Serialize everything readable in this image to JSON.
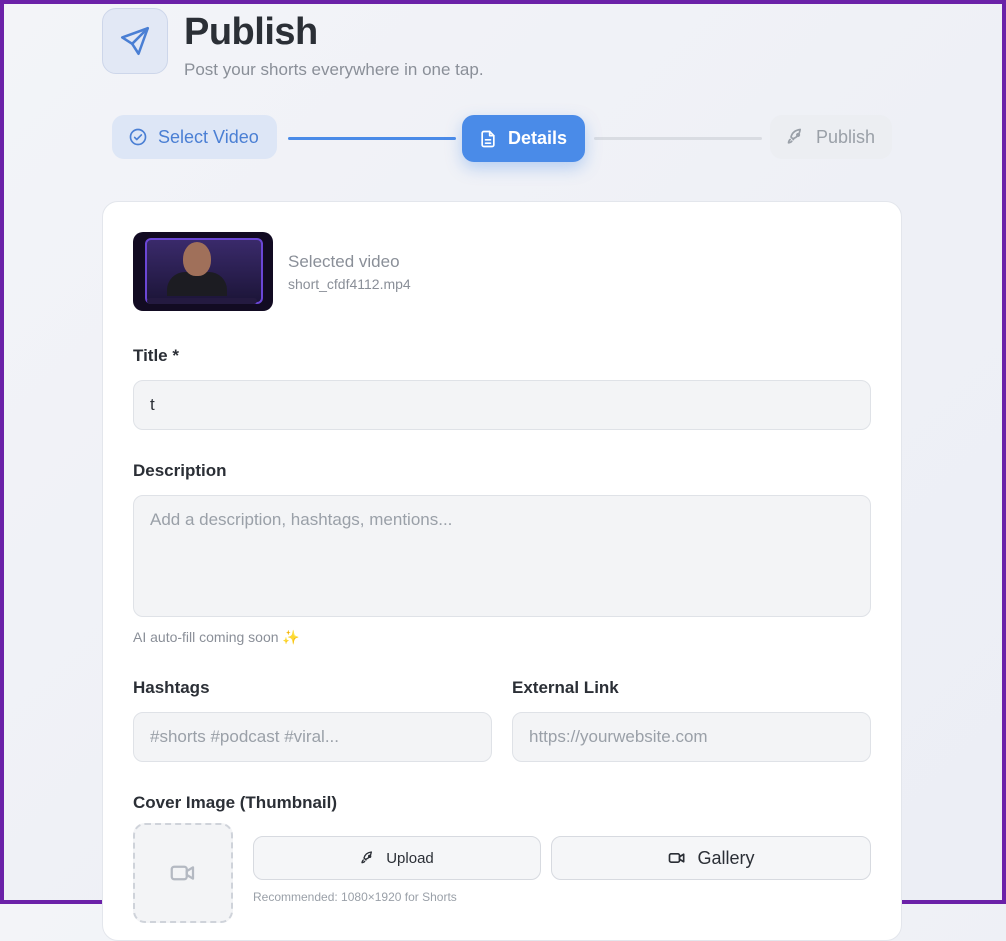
{
  "header": {
    "title": "Publish",
    "subtitle": "Post your shorts everywhere in one tap.",
    "icon": "send-icon"
  },
  "stepper": {
    "steps": [
      {
        "label": "Select Video",
        "state": "completed",
        "icon": "check-circle-icon"
      },
      {
        "label": "Details",
        "state": "active",
        "icon": "document-icon"
      },
      {
        "label": "Publish",
        "state": "upcoming",
        "icon": "rocket-icon"
      }
    ]
  },
  "video": {
    "label": "Selected video",
    "filename": "short_cfdf4112.mp4"
  },
  "form": {
    "title_label": "Title *",
    "title_value": "t",
    "description_label": "Description",
    "description_placeholder": "Add a description, hashtags, mentions...",
    "ai_hint": "AI auto-fill coming soon ✨",
    "hashtags_label": "Hashtags",
    "hashtags_placeholder": "#shorts #podcast #viral...",
    "link_label": "External Link",
    "link_placeholder": "https://yourwebsite.com",
    "cover_label": "Cover Image (Thumbnail)",
    "upload_label": "Upload",
    "gallery_label": "Gallery",
    "recommendation": "Recommended: 1080×1920 for Shorts"
  },
  "colors": {
    "accent": "#4a8be8",
    "frame": "#6b21a8"
  }
}
